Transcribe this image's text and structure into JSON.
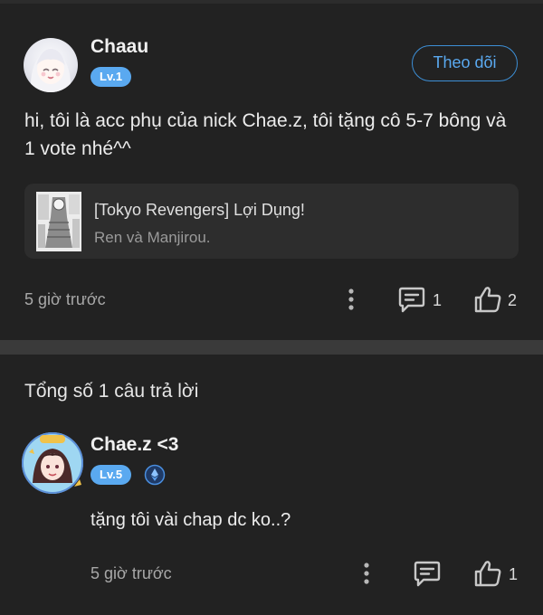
{
  "post": {
    "author": "Chaau",
    "level": "Lv.1",
    "follow_label": "Theo dõi",
    "text": "hi, tôi là acc phụ của nick Chae.z, tôi tặng cô 5-7 bông và 1 vote nhé^^",
    "reference": {
      "title": "[Tokyo Revengers] Lợi Dụng!",
      "subtitle": "Ren và Manjirou."
    },
    "time": "5 giờ trước",
    "comment_count": "1",
    "like_count": "2"
  },
  "replies_header": "Tổng số 1 câu trả lời",
  "reply": {
    "author": "Chae.z <3",
    "level": "Lv.5",
    "text": "tặng tôi vài chap dc ko..?",
    "time": "5 giờ trước",
    "like_count": "1"
  },
  "colors": {
    "background": "#222222",
    "accent": "#5aa9f0",
    "divider": "#3a3a3a",
    "card": "#2d2d2d"
  },
  "icons": [
    "more-vertical-icon",
    "comment-icon",
    "thumbs-up-icon",
    "verified-badge-icon"
  ]
}
